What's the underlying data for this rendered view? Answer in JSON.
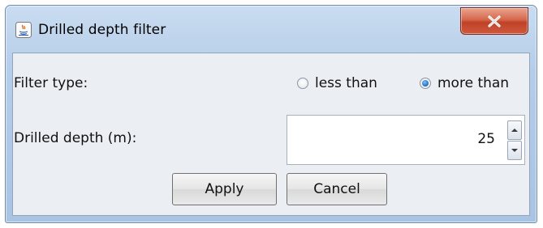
{
  "window": {
    "title": "Drilled depth filter",
    "icon": "java-app-icon",
    "close_icon": "close-icon",
    "close_color": "#c9442a"
  },
  "form": {
    "filter_type_label": "Filter type:",
    "options": [
      {
        "label": "less than",
        "checked": false
      },
      {
        "label": "more than",
        "checked": true
      }
    ],
    "depth_label": "Drilled depth (m):",
    "depth_value": "25",
    "apply_label": "Apply",
    "cancel_label": "Cancel"
  },
  "colors": {
    "titlebar": "#b6cde8",
    "client": "#ebeef3",
    "radio_selected": "#1f6cbf"
  }
}
